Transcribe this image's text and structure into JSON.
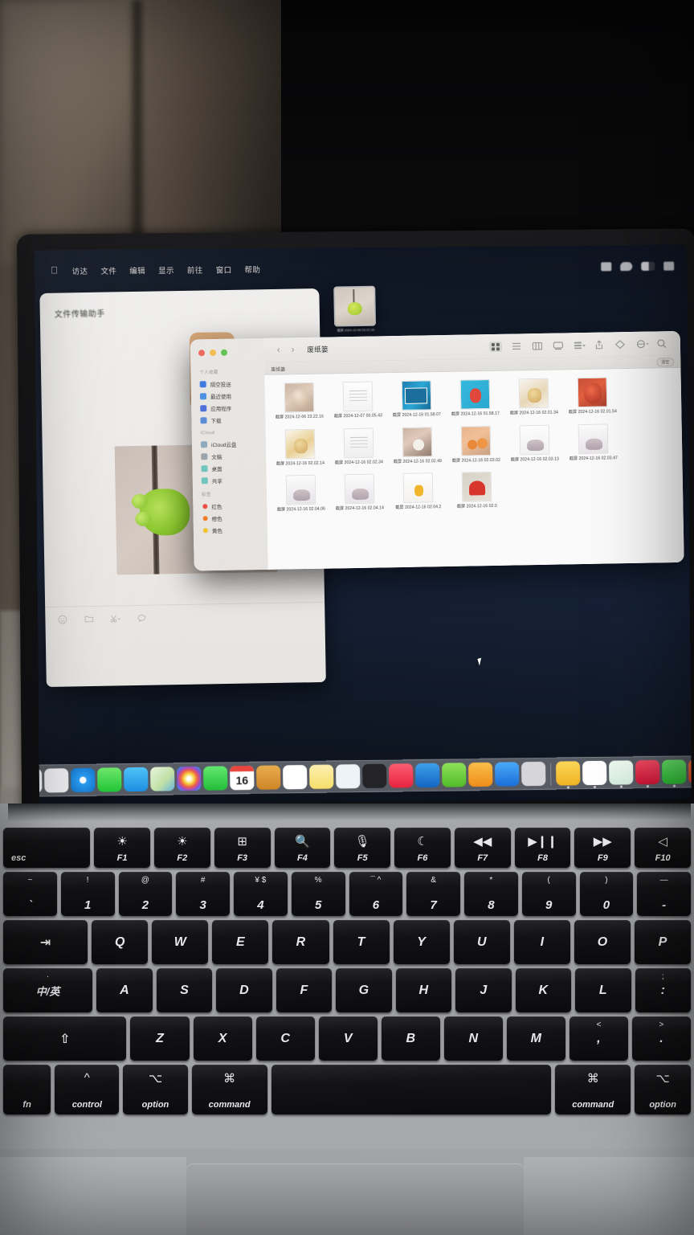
{
  "scene": {
    "description": "Photograph of a MacBook displaying macOS desktop",
    "wallpaper_color": "#17233a"
  },
  "menubar": {
    "apple_icon": "apple-logo-icon",
    "items": [
      "访达",
      "文件",
      "编辑",
      "显示",
      "前往",
      "窗口",
      "帮助"
    ],
    "status_icons": [
      "screen-mirroring-icon",
      "cloud-icon",
      "battery-icon",
      "control-center-icon"
    ]
  },
  "wechat_window": {
    "title": "文件传输助手",
    "toolbar_icons": [
      "emoji-icon",
      "folder-icon",
      "scissors-icon",
      "chat-bubble-icon"
    ]
  },
  "finder_window": {
    "title": "废纸篓",
    "back_arrow": "‹",
    "forward_arrow": "›",
    "pathbar_label": "废纸篓",
    "empty_button": "清空",
    "toolbar_icons": [
      {
        "name": "icon-view-icon",
        "active": true
      },
      {
        "name": "list-view-icon",
        "active": false
      },
      {
        "name": "column-view-icon",
        "active": false
      },
      {
        "name": "gallery-view-icon",
        "active": false
      },
      {
        "name": "group-by-icon",
        "active": false
      },
      {
        "name": "share-icon",
        "active": false
      },
      {
        "name": "tag-icon",
        "active": false
      },
      {
        "name": "action-menu-icon",
        "active": false
      },
      {
        "name": "search-icon",
        "active": false
      }
    ],
    "sidebar": {
      "groups": [
        {
          "title": "个人收藏",
          "items": [
            {
              "label": "隔空投送",
              "icon": "airdrop-icon",
              "color": "#3d7be0"
            },
            {
              "label": "最近使用",
              "icon": "recents-icon",
              "color": "#4a90e2"
            },
            {
              "label": "应用程序",
              "icon": "applications-icon",
              "color": "#4f6fd8"
            },
            {
              "label": "下载",
              "icon": "downloads-icon",
              "color": "#5a8bd6"
            }
          ]
        },
        {
          "title": "iCloud",
          "items": [
            {
              "label": "iCloud云盘",
              "icon": "icloud-drive-icon",
              "color": "#8fa8bb"
            },
            {
              "label": "文稿",
              "icon": "documents-icon",
              "color": "#9aa3ab"
            },
            {
              "label": "桌面",
              "icon": "desktop-icon",
              "color": "#6fc5bd"
            },
            {
              "label": "共享",
              "icon": "shared-icon",
              "color": "#6fc5bd"
            }
          ]
        },
        {
          "title": "标签",
          "items": [
            {
              "label": "红色",
              "icon": "tag-dot-icon",
              "color": "#ea4b3c"
            },
            {
              "label": "橙色",
              "icon": "tag-dot-icon",
              "color": "#f07a24"
            },
            {
              "label": "黄色",
              "icon": "tag-dot-icon",
              "color": "#f2c227"
            }
          ]
        }
      ]
    },
    "files": [
      {
        "name": "截屏 2024-12-06 23.22.16",
        "thumb": "teddy-bear"
      },
      {
        "name": "截屏 2024-12-07 00.05.43",
        "thumb": "document"
      },
      {
        "name": "截屏 2024-12-16 01.58.07",
        "thumb": "blue-screen"
      },
      {
        "name": "截屏 2024-12-16 01.58.17",
        "thumb": "cyan-photo"
      },
      {
        "name": "截屏 2024-12-16 02.01.34",
        "thumb": "tan-plush"
      },
      {
        "name": "截屏 2024-12-16 02.01.54",
        "thumb": "red-plush"
      },
      {
        "name": "截屏 2024-12-16 02.02.14",
        "thumb": "yellow-plush"
      },
      {
        "name": "截屏 2024-12-16 02.02.34",
        "thumb": "keychain"
      },
      {
        "name": "截屏 2024-12-16 02.02.49",
        "thumb": "hand-photo"
      },
      {
        "name": "截屏 2024-12-16 02.03.02",
        "thumb": "orange-fruit"
      },
      {
        "name": "截屏 2024-12-16 02.03.13",
        "thumb": "white-plush"
      },
      {
        "name": "截屏 2024-12-16 02.03.47",
        "thumb": "grey-plush"
      },
      {
        "name": "截屏 2024-12-16 02.04.06",
        "thumb": "grey-plush"
      },
      {
        "name": "截屏 2024-12-16 02.04.14",
        "thumb": "grey-plush"
      },
      {
        "name": "截屏 2024-12-16 02.04.2",
        "thumb": "yellow-small"
      },
      {
        "name": "截屏 2024-12-16 02.0",
        "thumb": "red-heart"
      }
    ]
  },
  "dock": {
    "apps": [
      {
        "name": "finder-icon",
        "color": "#1e8fe8",
        "running": true
      },
      {
        "name": "launchpad-icon",
        "color": "#ececf0",
        "running": false
      },
      {
        "name": "safari-icon",
        "color": "#1f97f4",
        "running": false
      },
      {
        "name": "messages-icon",
        "color": "#3fd24d",
        "running": false
      },
      {
        "name": "mail-icon",
        "color": "#29a9f7",
        "running": false
      },
      {
        "name": "maps-icon",
        "color": "#e8f2da",
        "running": false
      },
      {
        "name": "photos-icon",
        "color": "#fdfdfd",
        "running": false
      },
      {
        "name": "facetime-icon",
        "color": "#34ce4a",
        "running": false
      },
      {
        "name": "calendar-icon",
        "color": "#ffffff",
        "running": false,
        "day": "16"
      },
      {
        "name": "contacts-icon",
        "color": "#d99431",
        "running": false
      },
      {
        "name": "reminders-icon",
        "color": "#ffffff",
        "running": false
      },
      {
        "name": "notes-icon",
        "color": "#fbe48a",
        "running": false
      },
      {
        "name": "freeform-icon",
        "color": "#eef3f7",
        "running": false
      },
      {
        "name": "appletv-icon",
        "color": "#2b2b2e",
        "running": false
      },
      {
        "name": "music-icon",
        "color": "#f3455c",
        "running": false
      },
      {
        "name": "keynote-icon",
        "color": "#1e7fd6",
        "running": false
      },
      {
        "name": "numbers-icon",
        "color": "#6cd03f",
        "running": false
      },
      {
        "name": "pages-icon",
        "color": "#f7a52b",
        "running": false
      },
      {
        "name": "appstore-icon",
        "color": "#2c8df0",
        "running": false
      },
      {
        "name": "system-settings-icon",
        "color": "#d6d6da",
        "running": false
      },
      {
        "name": "lightbulb-app-icon",
        "color": "#f7c73a",
        "running": true
      },
      {
        "name": "wps-office-icon",
        "color": "#ffffff",
        "running": true
      },
      {
        "name": "video-player-icon",
        "color": "#e9f8ef",
        "running": true
      },
      {
        "name": "netease-music-icon",
        "color": "#e63050",
        "running": true
      },
      {
        "name": "wechat-icon",
        "color": "#4bcc52",
        "running": true
      },
      {
        "name": "orange-n-app-icon",
        "color": "#f25c2a",
        "running": true
      }
    ]
  },
  "keyboard": {
    "fn_row": [
      {
        "bottom": "esc",
        "top": "",
        "wide": 1.55
      },
      {
        "bottom": "F1",
        "top": "☀"
      },
      {
        "bottom": "F2",
        "top": "☀"
      },
      {
        "bottom": "F3",
        "top": "⊞"
      },
      {
        "bottom": "F4",
        "top": "🔍"
      },
      {
        "bottom": "F5",
        "top": "🎙"
      },
      {
        "bottom": "F6",
        "top": "☾"
      },
      {
        "bottom": "F7",
        "top": "◀◀"
      },
      {
        "bottom": "F8",
        "top": "▶❙❙"
      },
      {
        "bottom": "F9",
        "top": "▶▶"
      },
      {
        "bottom": "F10",
        "top": "◁"
      }
    ],
    "num_row": [
      {
        "sub": "~",
        "main": "`"
      },
      {
        "sub": "!",
        "main": "1"
      },
      {
        "sub": "@",
        "main": "2"
      },
      {
        "sub": "#",
        "main": "3"
      },
      {
        "sub": "¥ $",
        "main": "4"
      },
      {
        "sub": "%",
        "main": "5"
      },
      {
        "sub": "¯ ^",
        "main": "6"
      },
      {
        "sub": "&",
        "main": "7"
      },
      {
        "sub": "*",
        "main": "8"
      },
      {
        "sub": "(",
        "main": "9"
      },
      {
        "sub": ")",
        "main": "0"
      },
      {
        "sub": "—",
        "main": "-"
      }
    ],
    "q_row": [
      {
        "main": "⇥",
        "wide": 1.5
      },
      {
        "main": "Q"
      },
      {
        "main": "W"
      },
      {
        "main": "E"
      },
      {
        "main": "R"
      },
      {
        "main": "T"
      },
      {
        "main": "Y"
      },
      {
        "main": "U"
      },
      {
        "main": "I"
      },
      {
        "main": "O"
      },
      {
        "main": "P"
      }
    ],
    "a_row": [
      {
        "main": "中/英",
        "sub": "·",
        "wide": 1.6
      },
      {
        "main": "A"
      },
      {
        "main": "S"
      },
      {
        "main": "D"
      },
      {
        "main": "F"
      },
      {
        "main": "G"
      },
      {
        "main": "H"
      },
      {
        "main": "J"
      },
      {
        "main": "K"
      },
      {
        "main": "L"
      },
      {
        "main": ":",
        "sub": ";"
      }
    ],
    "z_row": [
      {
        "main": "⇧",
        "wide": 2.1
      },
      {
        "main": "Z"
      },
      {
        "main": "X"
      },
      {
        "main": "C"
      },
      {
        "main": "V"
      },
      {
        "main": "B"
      },
      {
        "main": "N"
      },
      {
        "main": "M"
      },
      {
        "main": ",",
        "sub": "<"
      },
      {
        "main": ".",
        "sub": ">"
      }
    ],
    "space_row": [
      {
        "bottom": "fn",
        "top": "",
        "wide": 0.85
      },
      {
        "bottom": "control",
        "top": "^",
        "wide": 1.15
      },
      {
        "bottom": "option",
        "top": "⌥",
        "wide": 1.15
      },
      {
        "bottom": "command",
        "top": "⌘",
        "wide": 1.35
      },
      {
        "bottom": "",
        "top": "",
        "wide": 5.0
      },
      {
        "bottom": "command",
        "top": "⌘",
        "wide": 1.35
      },
      {
        "bottom": "option",
        "top": "⌥",
        "wide": 1.0
      }
    ]
  }
}
